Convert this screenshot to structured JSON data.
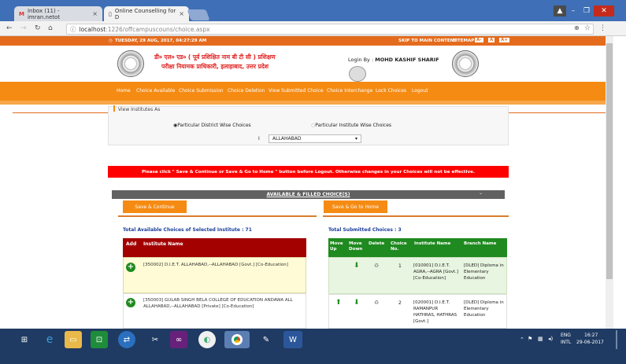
{
  "browser": {
    "tabs": [
      {
        "label": "Inbox (11) - imran.netot"
      },
      {
        "label": "Online Counselling for D"
      }
    ],
    "url_host": "localhost",
    "url_path": ":1226/offcampuscouns/choice.aspx"
  },
  "topbar": {
    "datetime": "TUESDAY, 29 AUG, 2017, 04:27:29 AM",
    "skip": "SKIP TO MAIN CONTENT",
    "sitemap": "SITEMAP",
    "a_minus": "A-",
    "a": "A",
    "a_plus": "A+"
  },
  "header": {
    "title_line1": "डी० एल० एड० ( पूर्व प्रशिक्षित नाम बी टी सी ) प्रशिक्षण",
    "title_line2": "परीक्षा नियामक प्राधिकारी, इलाहाबाद, उत्तर प्रदेश",
    "login_label": "Login By :",
    "login_user": "MOHD KASHIF SHARIF"
  },
  "menu": [
    "Home",
    "Choice Available",
    "Choice Submission",
    "Choice Deletion",
    "View Submitted Choice",
    "Choice Interchange",
    "Lock Choices",
    "Logout"
  ],
  "selection": {
    "section_label": "View Institutes As",
    "radio1": "Particular District Wise Choices",
    "radio2": "Particular Institute Wise Choices",
    "district_prefix": "I",
    "district_value": "ALLAHABAD"
  },
  "warning": "Please click \" Save & Continue or Save & Go to Home \" button before Logout. Otherwise changes in your Choices will not be effective.",
  "section_title": "AVAILABLE & FILLED CHOICE(S)",
  "buttons": {
    "save_continue": "Save & Continue",
    "save_home": "Save & Go to Home"
  },
  "available": {
    "caption": "Total Available Choices of Selected Institute : 71",
    "headers": [
      "Add",
      "Institute Name"
    ],
    "rows": [
      {
        "name": "[350002] D.I.E.T. ALLAHABAD,--ALLAHABAD [Govt.] [Co-Education]"
      },
      {
        "name": "[350003] GULAB SINGH BELA COLLEGE OF EDUCATION ANDAWA ALL ALLAHABAD,--ALLAHABAD [Private] [Co-Education]"
      }
    ]
  },
  "submitted": {
    "caption": "Total Submitted Choices : 3",
    "headers": [
      "Move Up",
      "Move Down",
      "Delete",
      "Choice No.",
      "Institute Name",
      "Branch Name"
    ],
    "rows": [
      {
        "choice": "1",
        "institute": "[010001] D.I.E.T. AGRA,--AGRA [Govt.] [Co-Education]",
        "branch": "[DLED] Diploma in Elementary Education"
      },
      {
        "choice": "2",
        "institute": "[020001] D.I.E.T. RAMANPUR HATHRAS, HATHRAS [Govt.]",
        "branch": "[DLED] Diploma in Elementary Education"
      }
    ]
  },
  "taskbar": {
    "lang": "ENG",
    "layout": "INTL",
    "time": "16:27",
    "date": "29-06-2017"
  },
  "colors": {
    "orange": "#f58b13",
    "dark_red": "#a30000",
    "green": "#1f8a1f",
    "warning_red": "#ff0000"
  }
}
